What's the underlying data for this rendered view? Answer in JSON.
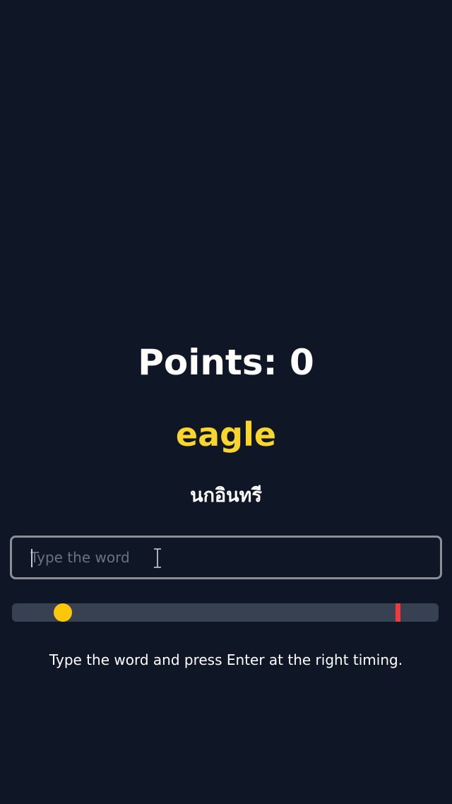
{
  "game": {
    "points_label": "Points: 0",
    "points": 0,
    "word": "eagle",
    "meaning": "นกอินทรี"
  },
  "input": {
    "value": "",
    "placeholder": "Type the word"
  },
  "timing_bar": {
    "marker_position": 0.12,
    "target_position": 0.905
  },
  "instructions": "Type the word and press Enter at the right timing.",
  "colors": {
    "background": "#0f1626",
    "word": "#fad52b",
    "track": "#374151",
    "marker": "#fcc60a",
    "target": "#ef3b3b"
  }
}
